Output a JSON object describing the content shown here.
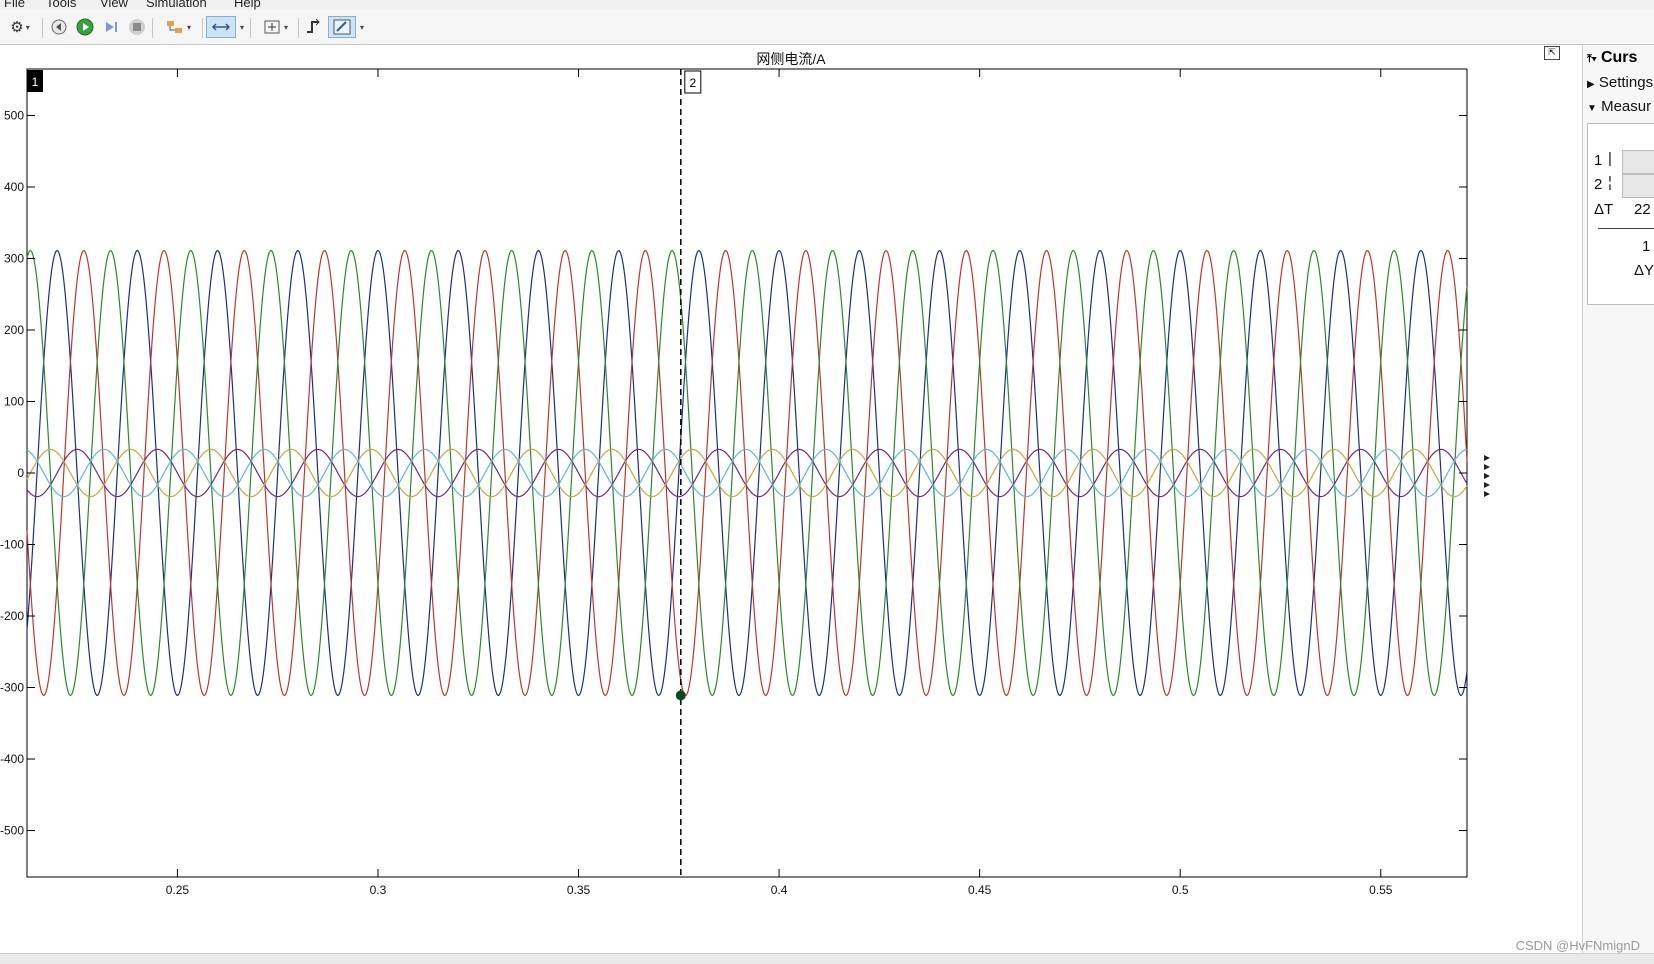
{
  "menu": {
    "items": [
      "File",
      "Tools",
      "View",
      "Simulation",
      "Help"
    ]
  },
  "toolbar": {
    "buttons": [
      "gear-icon",
      "step-back-icon",
      "run-icon",
      "step-forward-icon",
      "stop-icon",
      "highlight-block-icon",
      "zoom-icon",
      "autoscale-icon",
      "triggers-icon",
      "cursor-measurements-icon"
    ]
  },
  "plot": {
    "title": "网侧电流/A",
    "cursor1_label": "1",
    "cursor2_label": "2",
    "cursor2_x": 0.3755,
    "cursor2_marker_y": -311
  },
  "cursor_panel": {
    "title": "Curs",
    "settings": "Settings",
    "measurements": "Measur",
    "row1": "1",
    "row2": "2",
    "delta_t_label": "ΔT",
    "delta_t_value": "22",
    "lower_1": "1",
    "lower_delta": "ΔY"
  },
  "watermark": "CSDN @HvFNmignD",
  "colors": {
    "series1": "#1a2f8f",
    "series2": "#c0352b",
    "series3": "#2a8a2a",
    "series4": "#6a2a8a",
    "series5": "#c5a83a",
    "series6": "#5ab8d8"
  },
  "chart_data": {
    "type": "line",
    "title": "网侧电流/A",
    "xlabel": "",
    "ylabel": "",
    "xlim": [
      0.2125,
      0.5715
    ],
    "ylim": [
      -565,
      565
    ],
    "xticks": [
      0.25,
      0.3,
      0.35,
      0.4,
      0.45,
      0.5,
      0.55
    ],
    "xtick_labels": [
      "0.25",
      "0.3",
      "0.35",
      "0.4",
      "0.45",
      "0.5",
      "0.55"
    ],
    "yticks": [
      500,
      400,
      300,
      200,
      100,
      0,
      -100,
      -200,
      -300,
      -400,
      -500
    ],
    "ytick_labels": [
      "500",
      "400",
      "300",
      "200",
      "100",
      "0",
      "-100",
      "-200",
      "-300",
      "-400",
      "-500"
    ],
    "frequency_hz": 50,
    "series": [
      {
        "amplitude": 311,
        "phase_deg": 90,
        "color": "#1a2f8f"
      },
      {
        "amplitude": 311,
        "phase_deg": -30,
        "color": "#c0352b"
      },
      {
        "amplitude": 311,
        "phase_deg": 210,
        "color": "#2a8a2a"
      },
      {
        "amplitude": 33,
        "phase_deg": 0,
        "color": "#6a2a8a"
      },
      {
        "amplitude": 33,
        "phase_deg": 120,
        "color": "#c5a83a"
      },
      {
        "amplitude": 33,
        "phase_deg": 240,
        "color": "#5ab8d8"
      }
    ],
    "grid": false,
    "legend": "none"
  }
}
